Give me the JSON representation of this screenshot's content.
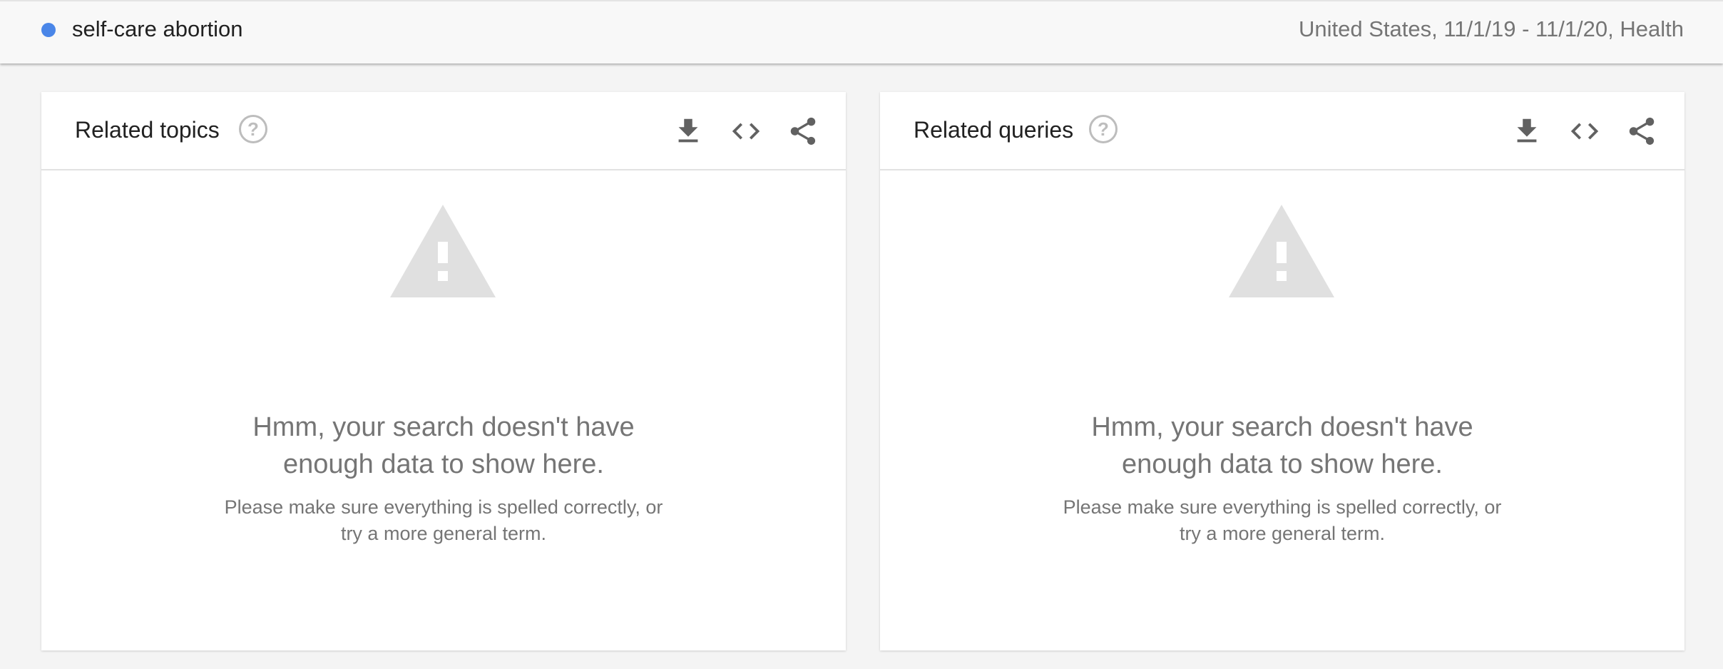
{
  "term": {
    "label": "self-care abortion",
    "dot_color": "#4a86e8",
    "meta": "United States, 11/1/19 - 11/1/20, Health"
  },
  "cards": [
    {
      "title": "Related topics",
      "help_glyph": "?",
      "icons": [
        "help-icon",
        "download-icon",
        "embed-code-icon",
        "share-icon"
      ],
      "empty": {
        "icon": "warning-triangle-icon",
        "heading_line1": "Hmm, your search doesn't have",
        "heading_line2": "enough data to show here.",
        "sub_line1": "Please make sure everything is spelled correctly, or",
        "sub_line2": "try a more general term."
      }
    },
    {
      "title": "Related queries",
      "help_glyph": "?",
      "icons": [
        "help-icon",
        "download-icon",
        "embed-code-icon",
        "share-icon"
      ],
      "empty": {
        "icon": "warning-triangle-icon",
        "heading_line1": "Hmm, your search doesn't have",
        "heading_line2": "enough data to show here.",
        "sub_line1": "Please make sure everything is spelled correctly, or",
        "sub_line2": "try a more general term."
      }
    }
  ],
  "colors": {
    "icon_gray": "#616161",
    "muted_text": "#757575",
    "warning_fill": "#e0e0e0"
  }
}
